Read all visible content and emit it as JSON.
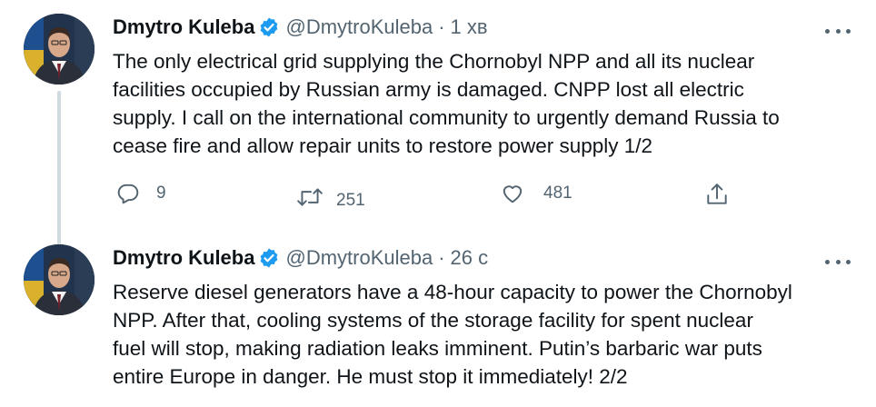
{
  "tweets": [
    {
      "author": "Dmytro Kuleba",
      "handle": "@DmytroKuleba",
      "separator": "·",
      "time": "1 хв",
      "text": "The only electrical grid supplying the Chornobyl NPP and all its nuclear\nfacilities occupied by Russian army is damaged. CNPP lost all electric\nsupply. I call on the international community to urgently demand Russia to\ncease fire and allow repair units to restore power supply 1/2",
      "replies": "9",
      "retweets": "251",
      "likes": "481"
    },
    {
      "author": "Dmytro Kuleba",
      "handle": "@DmytroKuleba",
      "separator": "·",
      "time": "26 с",
      "text": "Reserve diesel generators have a 48-hour capacity to power the Chornobyl\nNPP. After that, cooling systems of the storage facility for spent nuclear\nfuel will stop, making radiation leaks imminent. Putin’s barbaric war puts\nentire Europe in danger. He must stop it immediately! 2/2"
    }
  ],
  "icons": {
    "verified": "verified-badge-icon",
    "more": "more-options-icon",
    "reply": "reply-icon",
    "retweet": "retweet-icon",
    "like": "like-icon",
    "share": "share-icon"
  },
  "colors": {
    "text": "#0f1419",
    "secondary": "#536471",
    "verified": "#1d9bf0",
    "thread_line": "#cfd9de"
  }
}
